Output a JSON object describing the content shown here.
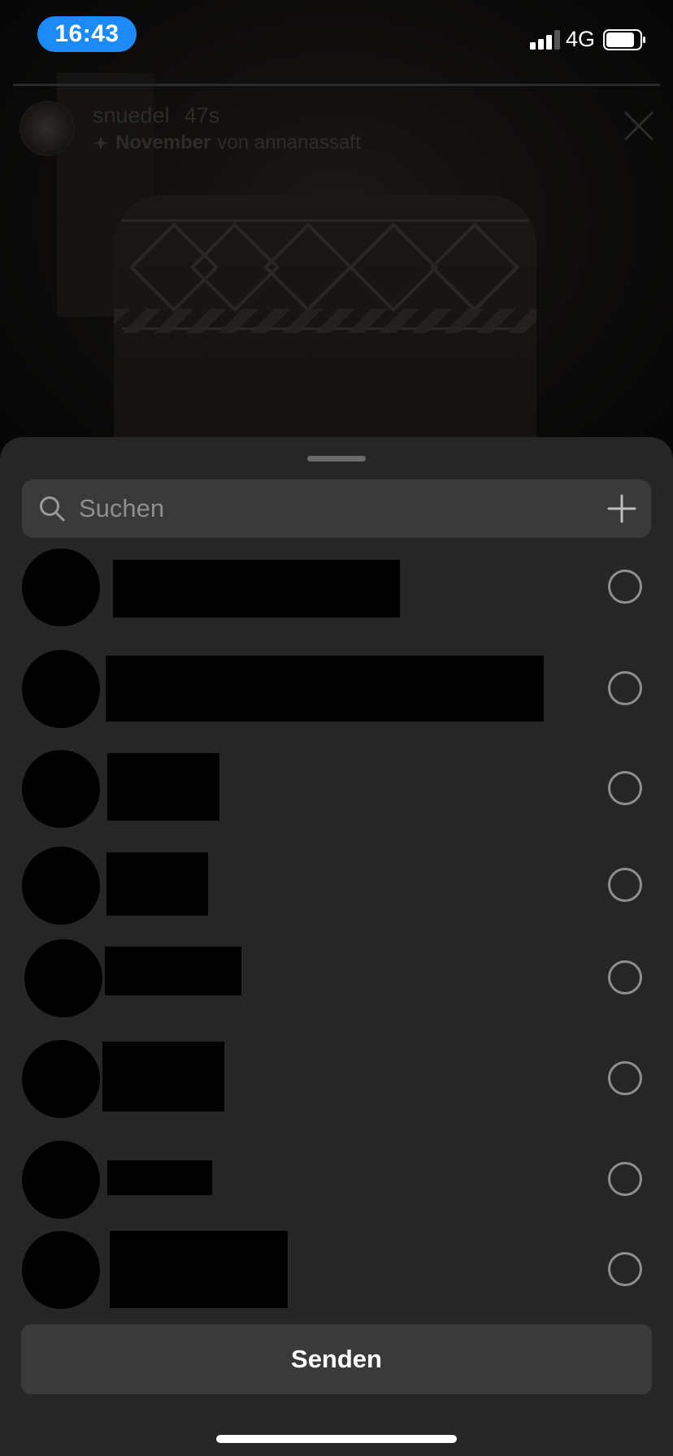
{
  "status_bar": {
    "time": "16:43",
    "network": "4G",
    "icons": [
      "signal-bars-icon",
      "battery-icon"
    ],
    "time_pill_color": "#1c8bf7"
  },
  "story": {
    "username": "snuedel",
    "age": "47s",
    "music_title": "November",
    "music_by": "von annanassaft",
    "icons": [
      "sparkle-icon",
      "close-icon"
    ]
  },
  "share_sheet": {
    "search_placeholder": "Suchen",
    "add_icon": "plus-icon",
    "recipients": [
      {
        "name": "",
        "selected": false
      },
      {
        "name": "",
        "selected": false
      },
      {
        "name": "",
        "selected": false
      },
      {
        "name": "",
        "selected": false
      },
      {
        "name": "",
        "selected": false
      },
      {
        "name": "",
        "selected": false
      },
      {
        "name": "",
        "selected": false
      },
      {
        "name": "",
        "selected": false
      }
    ],
    "send_label": "Senden"
  },
  "colors": {
    "sheet_bg": "#262626",
    "field_bg": "#3a3a3a",
    "redaction": "#000000"
  }
}
